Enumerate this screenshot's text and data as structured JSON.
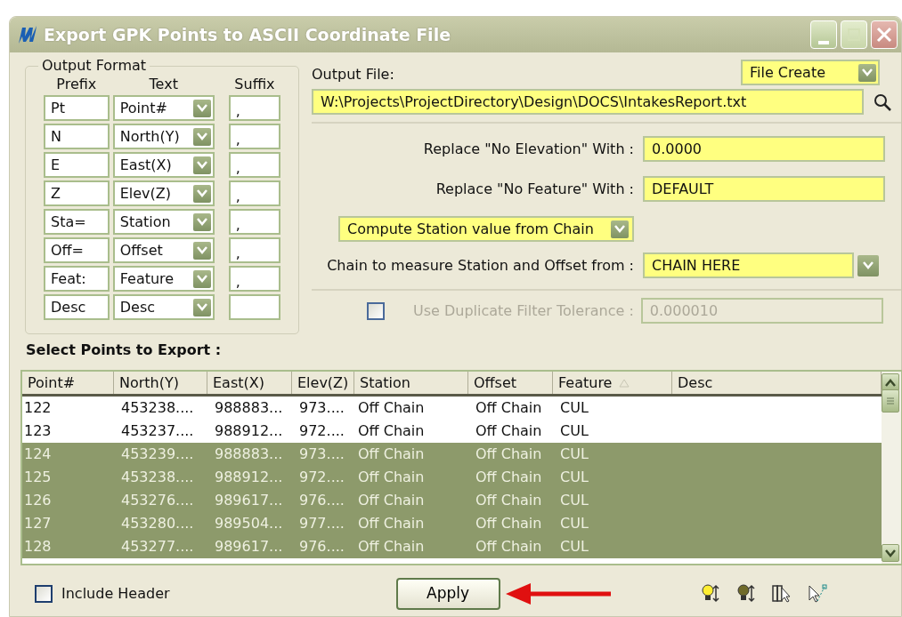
{
  "window": {
    "title": "Export GPK Points to ASCII Coordinate File"
  },
  "output_format": {
    "title": "Output Format",
    "headers": [
      "Prefix",
      "Text",
      "Suffix"
    ],
    "rows": [
      {
        "prefix": "Pt",
        "text": "Point#",
        "suffix": ","
      },
      {
        "prefix": "N",
        "text": "North(Y)",
        "suffix": ","
      },
      {
        "prefix": "E",
        "text": "East(X)",
        "suffix": ","
      },
      {
        "prefix": "Z",
        "text": "Elev(Z)",
        "suffix": ","
      },
      {
        "prefix": "Sta=",
        "text": "Station",
        "suffix": ","
      },
      {
        "prefix": "Off=",
        "text": "Offset",
        "suffix": ","
      },
      {
        "prefix": "Feat:",
        "text": "Feature",
        "suffix": ","
      },
      {
        "prefix": "Desc",
        "text": "Desc"
      }
    ]
  },
  "output_file": {
    "label": "Output File:",
    "mode": "File Create",
    "path": "W:\\Projects\\ProjectDirectory\\Design\\DOCS\\IntakesReport.txt"
  },
  "replace_elevation": {
    "label": "Replace \"No Elevation\" With :",
    "value": "0.0000"
  },
  "replace_feature": {
    "label": "Replace \"No Feature\" With :",
    "value": "DEFAULT"
  },
  "station_mode": "Compute Station value from Chain",
  "chain": {
    "label": "Chain to measure Station and Offset from :",
    "value": "CHAIN HERE"
  },
  "duplicate_filter": {
    "label": "Use Duplicate Filter Tolerance :",
    "value": "0.000010",
    "checked": false,
    "disabled": true
  },
  "points": {
    "title": "Select Points to Export :",
    "columns": [
      {
        "label": "Point#",
        "sorted": false
      },
      {
        "label": "North(Y)",
        "sorted": false
      },
      {
        "label": "East(X)",
        "sorted": false
      },
      {
        "label": "Elev(Z)",
        "sorted": false
      },
      {
        "label": "Station",
        "sorted": false
      },
      {
        "label": "Offset",
        "sorted": false
      },
      {
        "label": "Feature",
        "sorted": true
      },
      {
        "label": "Desc",
        "sorted": false
      }
    ],
    "rows": [
      {
        "cells": [
          "122",
          "453238....",
          "988883...",
          "973....",
          "Off Chain",
          "Off Chain",
          "CUL"
        ],
        "selected": false
      },
      {
        "cells": [
          "123",
          "453237....",
          "988912...",
          "972....",
          "Off Chain",
          "Off Chain",
          "CUL"
        ],
        "selected": false
      },
      {
        "cells": [
          "124",
          "453239....",
          "988883...",
          "973....",
          "Off Chain",
          "Off Chain",
          "CUL"
        ],
        "selected": true
      },
      {
        "cells": [
          "125",
          "453238....",
          "988912...",
          "972....",
          "Off Chain",
          "Off Chain",
          "CUL"
        ],
        "selected": true
      },
      {
        "cells": [
          "126",
          "453276....",
          "989617...",
          "976....",
          "Off Chain",
          "Off Chain",
          "CUL"
        ],
        "selected": true
      },
      {
        "cells": [
          "127",
          "453280....",
          "989504...",
          "977....",
          "Off Chain",
          "Off Chain",
          "CUL"
        ],
        "selected": true
      },
      {
        "cells": [
          "128",
          "453277....",
          "989617...",
          "976....",
          "Off Chain",
          "Off Chain",
          "CUL"
        ],
        "selected": true
      }
    ]
  },
  "include_header": {
    "label": "Include Header",
    "checked": false
  },
  "apply_button": "Apply"
}
